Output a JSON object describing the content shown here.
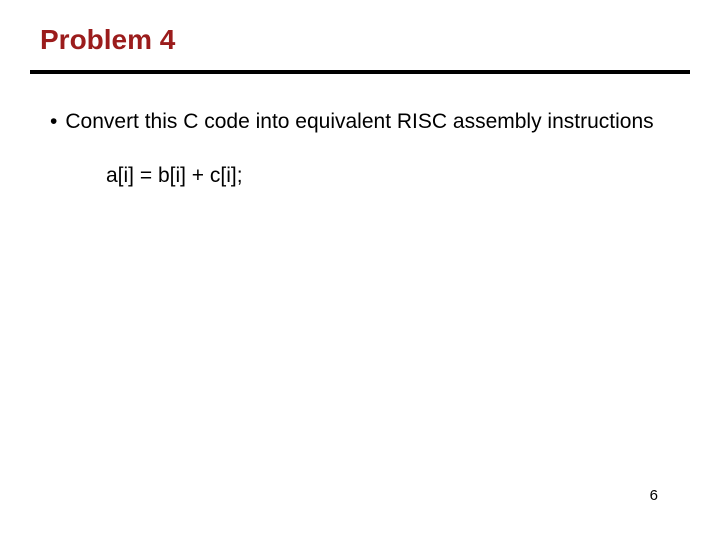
{
  "title": "Problem 4",
  "bullet": {
    "marker": "•",
    "text": "Convert this C code into equivalent RISC assembly instructions"
  },
  "code": "a[i] = b[i] + c[i];",
  "page_number": "6"
}
